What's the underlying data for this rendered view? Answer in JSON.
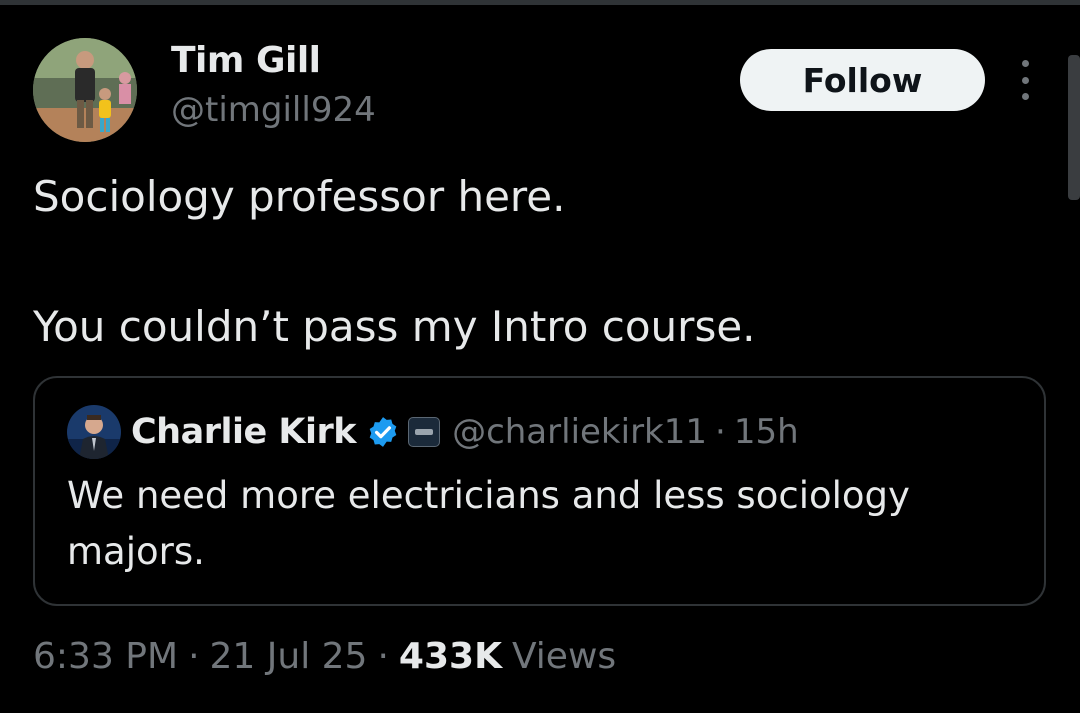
{
  "tweet": {
    "author": {
      "name": "Tim Gill",
      "handle": "@timgill924"
    },
    "follow_label": "Follow",
    "text_lines": [
      "Sociology professor here.",
      "You couldn’t pass my Intro course."
    ],
    "quoted": {
      "name": "Charlie Kirk",
      "verified": true,
      "handle": "@charliekirk11",
      "separator": "·",
      "time": "15h",
      "text_lines": [
        "We need more electricians and less sociology",
        "majors."
      ]
    },
    "meta": {
      "time": "6:33 PM",
      "separator": "·",
      "date": "21 Jul 25",
      "views_count": "433K",
      "views_label": "Views"
    }
  },
  "icons": {
    "more": "more-vertical-icon",
    "verified": "verified-badge-icon",
    "affiliation": "affiliation-badge-icon"
  },
  "colors": {
    "background": "#000000",
    "text_primary": "#e7e9ea",
    "text_secondary": "#71767b",
    "border": "#2f3336",
    "button_bg": "#eff3f4",
    "verified_blue": "#1d9bf0"
  }
}
